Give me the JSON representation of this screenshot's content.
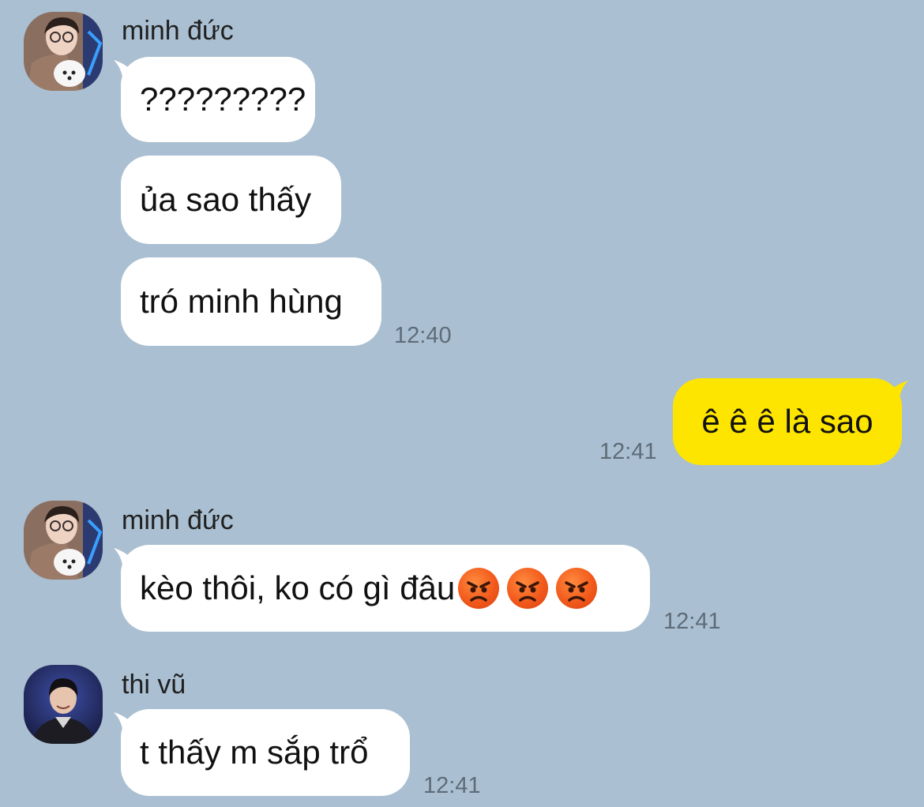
{
  "chat": {
    "groups": [
      {
        "sender": "minh đức",
        "avatar": "avatar-minh-duc",
        "messages": [
          "?????????",
          "ủa sao thấy",
          "tró minh hùng"
        ],
        "time": "12:40"
      },
      {
        "sender": "me",
        "messages": [
          "ê ê ê là sao"
        ],
        "time": "12:41"
      },
      {
        "sender": "minh đức",
        "avatar": "avatar-minh-duc",
        "messages": [
          "kèo thôi, ko có gì đâu"
        ],
        "emoji": [
          "angry-face-emoji",
          "angry-face-emoji",
          "angry-face-emoji"
        ],
        "time": "12:41"
      },
      {
        "sender": "thi vũ",
        "avatar": "avatar-thi-vu",
        "messages": [
          "t thấy m sắp trổ"
        ],
        "time": "12:41"
      }
    ]
  },
  "colors": {
    "background": "#aabfd1",
    "incoming_bubble": "#ffffff",
    "outgoing_bubble": "#fee500",
    "timestamp": "#5e6c79",
    "emoji": "#f25a1c"
  }
}
